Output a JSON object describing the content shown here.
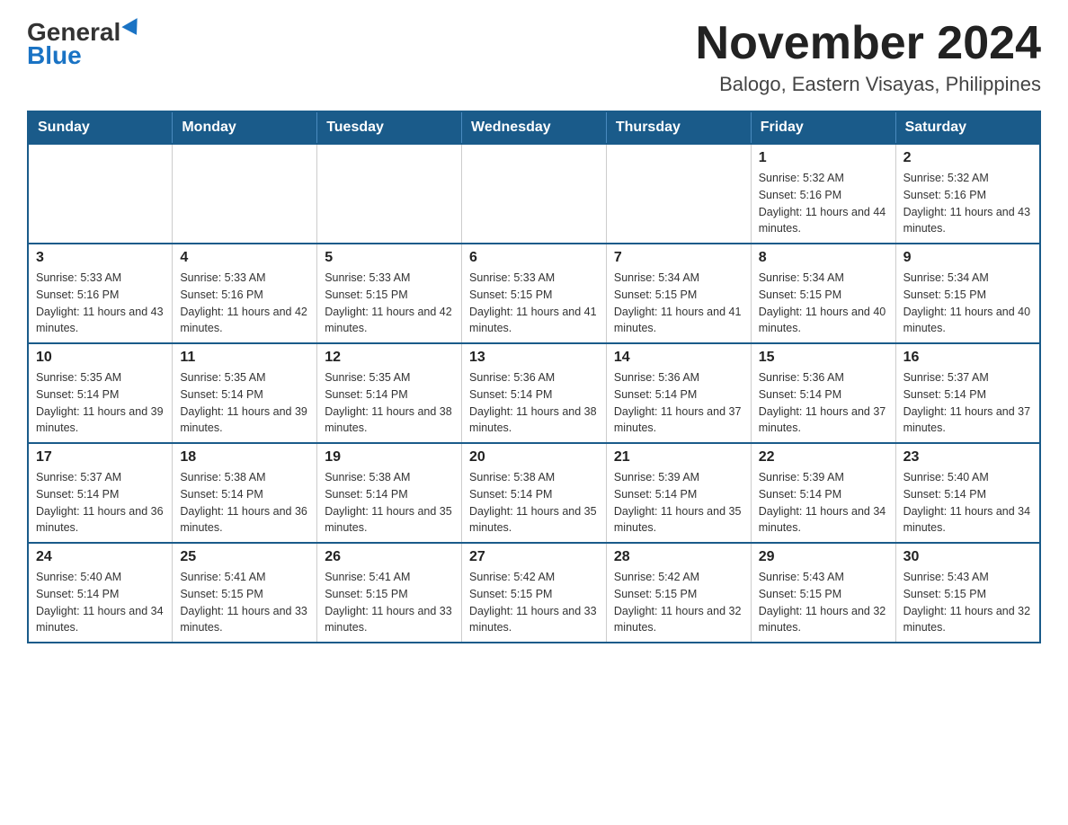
{
  "header": {
    "logo_general": "General",
    "logo_blue": "Blue",
    "month_title": "November 2024",
    "location": "Balogo, Eastern Visayas, Philippines"
  },
  "days_of_week": [
    "Sunday",
    "Monday",
    "Tuesday",
    "Wednesday",
    "Thursday",
    "Friday",
    "Saturday"
  ],
  "weeks": [
    {
      "days": [
        {
          "number": "",
          "info": ""
        },
        {
          "number": "",
          "info": ""
        },
        {
          "number": "",
          "info": ""
        },
        {
          "number": "",
          "info": ""
        },
        {
          "number": "",
          "info": ""
        },
        {
          "number": "1",
          "info": "Sunrise: 5:32 AM\nSunset: 5:16 PM\nDaylight: 11 hours and 44 minutes."
        },
        {
          "number": "2",
          "info": "Sunrise: 5:32 AM\nSunset: 5:16 PM\nDaylight: 11 hours and 43 minutes."
        }
      ]
    },
    {
      "days": [
        {
          "number": "3",
          "info": "Sunrise: 5:33 AM\nSunset: 5:16 PM\nDaylight: 11 hours and 43 minutes."
        },
        {
          "number": "4",
          "info": "Sunrise: 5:33 AM\nSunset: 5:16 PM\nDaylight: 11 hours and 42 minutes."
        },
        {
          "number": "5",
          "info": "Sunrise: 5:33 AM\nSunset: 5:15 PM\nDaylight: 11 hours and 42 minutes."
        },
        {
          "number": "6",
          "info": "Sunrise: 5:33 AM\nSunset: 5:15 PM\nDaylight: 11 hours and 41 minutes."
        },
        {
          "number": "7",
          "info": "Sunrise: 5:34 AM\nSunset: 5:15 PM\nDaylight: 11 hours and 41 minutes."
        },
        {
          "number": "8",
          "info": "Sunrise: 5:34 AM\nSunset: 5:15 PM\nDaylight: 11 hours and 40 minutes."
        },
        {
          "number": "9",
          "info": "Sunrise: 5:34 AM\nSunset: 5:15 PM\nDaylight: 11 hours and 40 minutes."
        }
      ]
    },
    {
      "days": [
        {
          "number": "10",
          "info": "Sunrise: 5:35 AM\nSunset: 5:14 PM\nDaylight: 11 hours and 39 minutes."
        },
        {
          "number": "11",
          "info": "Sunrise: 5:35 AM\nSunset: 5:14 PM\nDaylight: 11 hours and 39 minutes."
        },
        {
          "number": "12",
          "info": "Sunrise: 5:35 AM\nSunset: 5:14 PM\nDaylight: 11 hours and 38 minutes."
        },
        {
          "number": "13",
          "info": "Sunrise: 5:36 AM\nSunset: 5:14 PM\nDaylight: 11 hours and 38 minutes."
        },
        {
          "number": "14",
          "info": "Sunrise: 5:36 AM\nSunset: 5:14 PM\nDaylight: 11 hours and 37 minutes."
        },
        {
          "number": "15",
          "info": "Sunrise: 5:36 AM\nSunset: 5:14 PM\nDaylight: 11 hours and 37 minutes."
        },
        {
          "number": "16",
          "info": "Sunrise: 5:37 AM\nSunset: 5:14 PM\nDaylight: 11 hours and 37 minutes."
        }
      ]
    },
    {
      "days": [
        {
          "number": "17",
          "info": "Sunrise: 5:37 AM\nSunset: 5:14 PM\nDaylight: 11 hours and 36 minutes."
        },
        {
          "number": "18",
          "info": "Sunrise: 5:38 AM\nSunset: 5:14 PM\nDaylight: 11 hours and 36 minutes."
        },
        {
          "number": "19",
          "info": "Sunrise: 5:38 AM\nSunset: 5:14 PM\nDaylight: 11 hours and 35 minutes."
        },
        {
          "number": "20",
          "info": "Sunrise: 5:38 AM\nSunset: 5:14 PM\nDaylight: 11 hours and 35 minutes."
        },
        {
          "number": "21",
          "info": "Sunrise: 5:39 AM\nSunset: 5:14 PM\nDaylight: 11 hours and 35 minutes."
        },
        {
          "number": "22",
          "info": "Sunrise: 5:39 AM\nSunset: 5:14 PM\nDaylight: 11 hours and 34 minutes."
        },
        {
          "number": "23",
          "info": "Sunrise: 5:40 AM\nSunset: 5:14 PM\nDaylight: 11 hours and 34 minutes."
        }
      ]
    },
    {
      "days": [
        {
          "number": "24",
          "info": "Sunrise: 5:40 AM\nSunset: 5:14 PM\nDaylight: 11 hours and 34 minutes."
        },
        {
          "number": "25",
          "info": "Sunrise: 5:41 AM\nSunset: 5:15 PM\nDaylight: 11 hours and 33 minutes."
        },
        {
          "number": "26",
          "info": "Sunrise: 5:41 AM\nSunset: 5:15 PM\nDaylight: 11 hours and 33 minutes."
        },
        {
          "number": "27",
          "info": "Sunrise: 5:42 AM\nSunset: 5:15 PM\nDaylight: 11 hours and 33 minutes."
        },
        {
          "number": "28",
          "info": "Sunrise: 5:42 AM\nSunset: 5:15 PM\nDaylight: 11 hours and 32 minutes."
        },
        {
          "number": "29",
          "info": "Sunrise: 5:43 AM\nSunset: 5:15 PM\nDaylight: 11 hours and 32 minutes."
        },
        {
          "number": "30",
          "info": "Sunrise: 5:43 AM\nSunset: 5:15 PM\nDaylight: 11 hours and 32 minutes."
        }
      ]
    }
  ]
}
